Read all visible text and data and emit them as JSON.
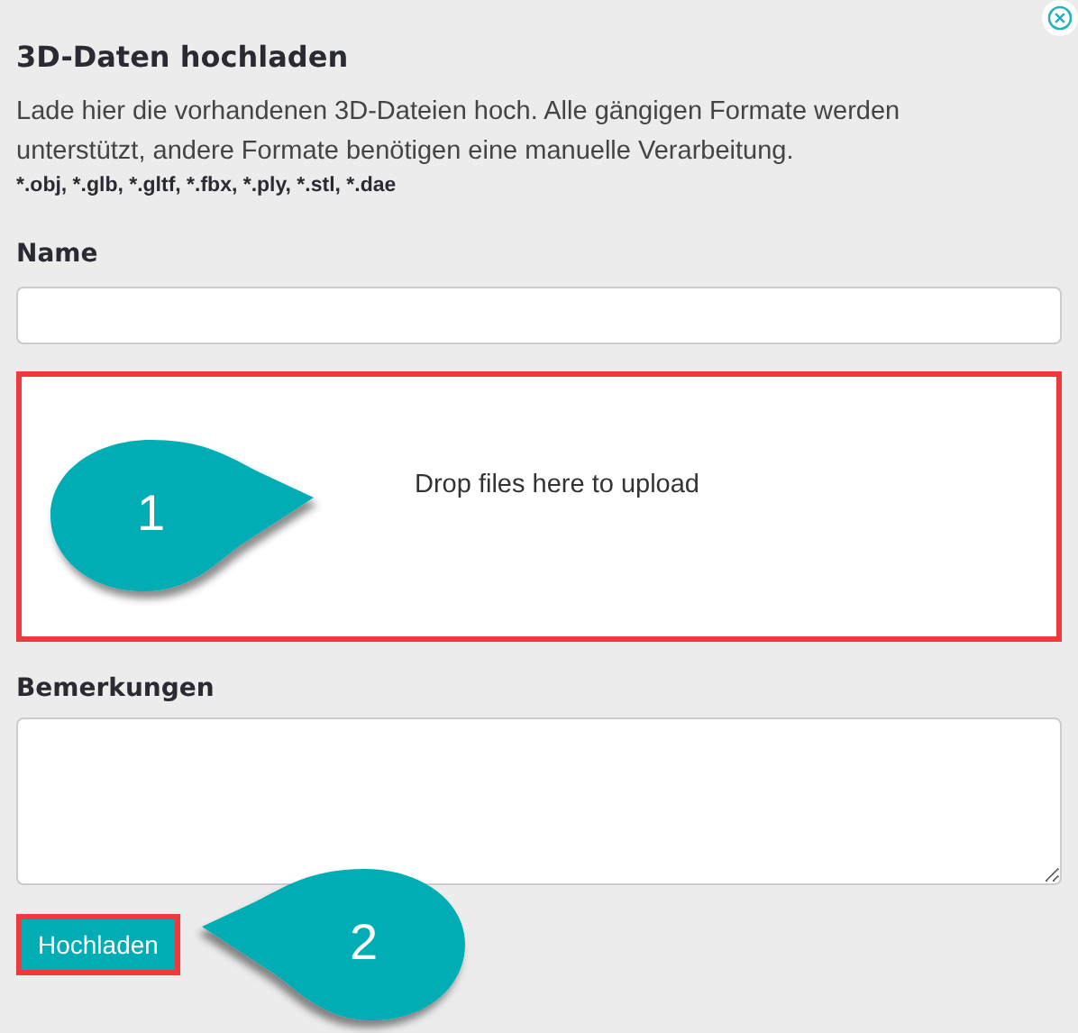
{
  "dialog": {
    "title": "3D-Daten hochladen",
    "description": "Lade hier die vorhandenen 3D-Dateien hoch. Alle gängigen Formate werden unterstützt, andere Formate benötigen eine manuelle Verarbeitung.",
    "formats": "*.obj, *.glb, *.gltf, *.fbx, *.ply, *.stl, *.dae"
  },
  "name_field": {
    "label": "Name"
  },
  "dropzone": {
    "text": "Drop files here to upload"
  },
  "remarks_field": {
    "label": "Bemerkungen"
  },
  "upload_button": {
    "label": "Hochladen"
  },
  "callouts": [
    {
      "number": "1",
      "kind": "right"
    },
    {
      "number": "2",
      "kind": "left"
    }
  ]
}
